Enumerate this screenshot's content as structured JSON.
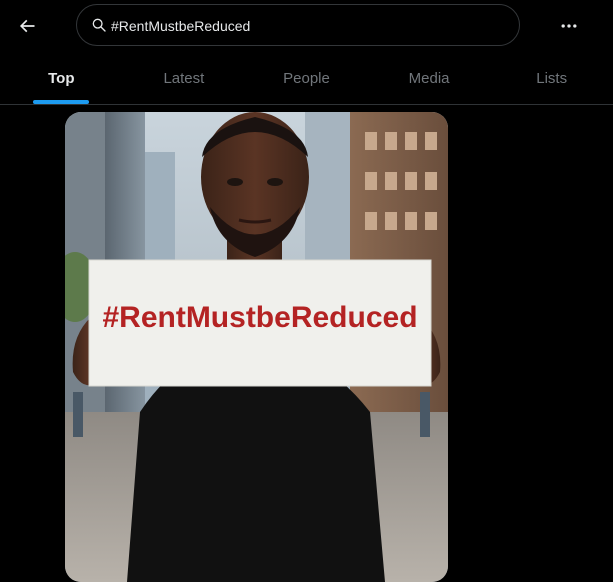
{
  "header": {
    "back_icon": "arrow-left-icon",
    "search": {
      "icon": "search-icon",
      "value": "#RentMustbeReduced"
    },
    "more_icon": "more-horizontal-icon"
  },
  "tabs": [
    {
      "label": "Top",
      "active": true
    },
    {
      "label": "Latest",
      "active": false
    },
    {
      "label": "People",
      "active": false
    },
    {
      "label": "Media",
      "active": false
    },
    {
      "label": "Lists",
      "active": false
    }
  ],
  "post": {
    "media": {
      "sign_text": "#RentMustbeReduced"
    }
  },
  "colors": {
    "background": "#000000",
    "accent": "#1d9bf0",
    "text_primary": "#e7e9ea",
    "text_secondary": "#71767b",
    "border": "#2f3336",
    "sign_text": "#b42323"
  }
}
